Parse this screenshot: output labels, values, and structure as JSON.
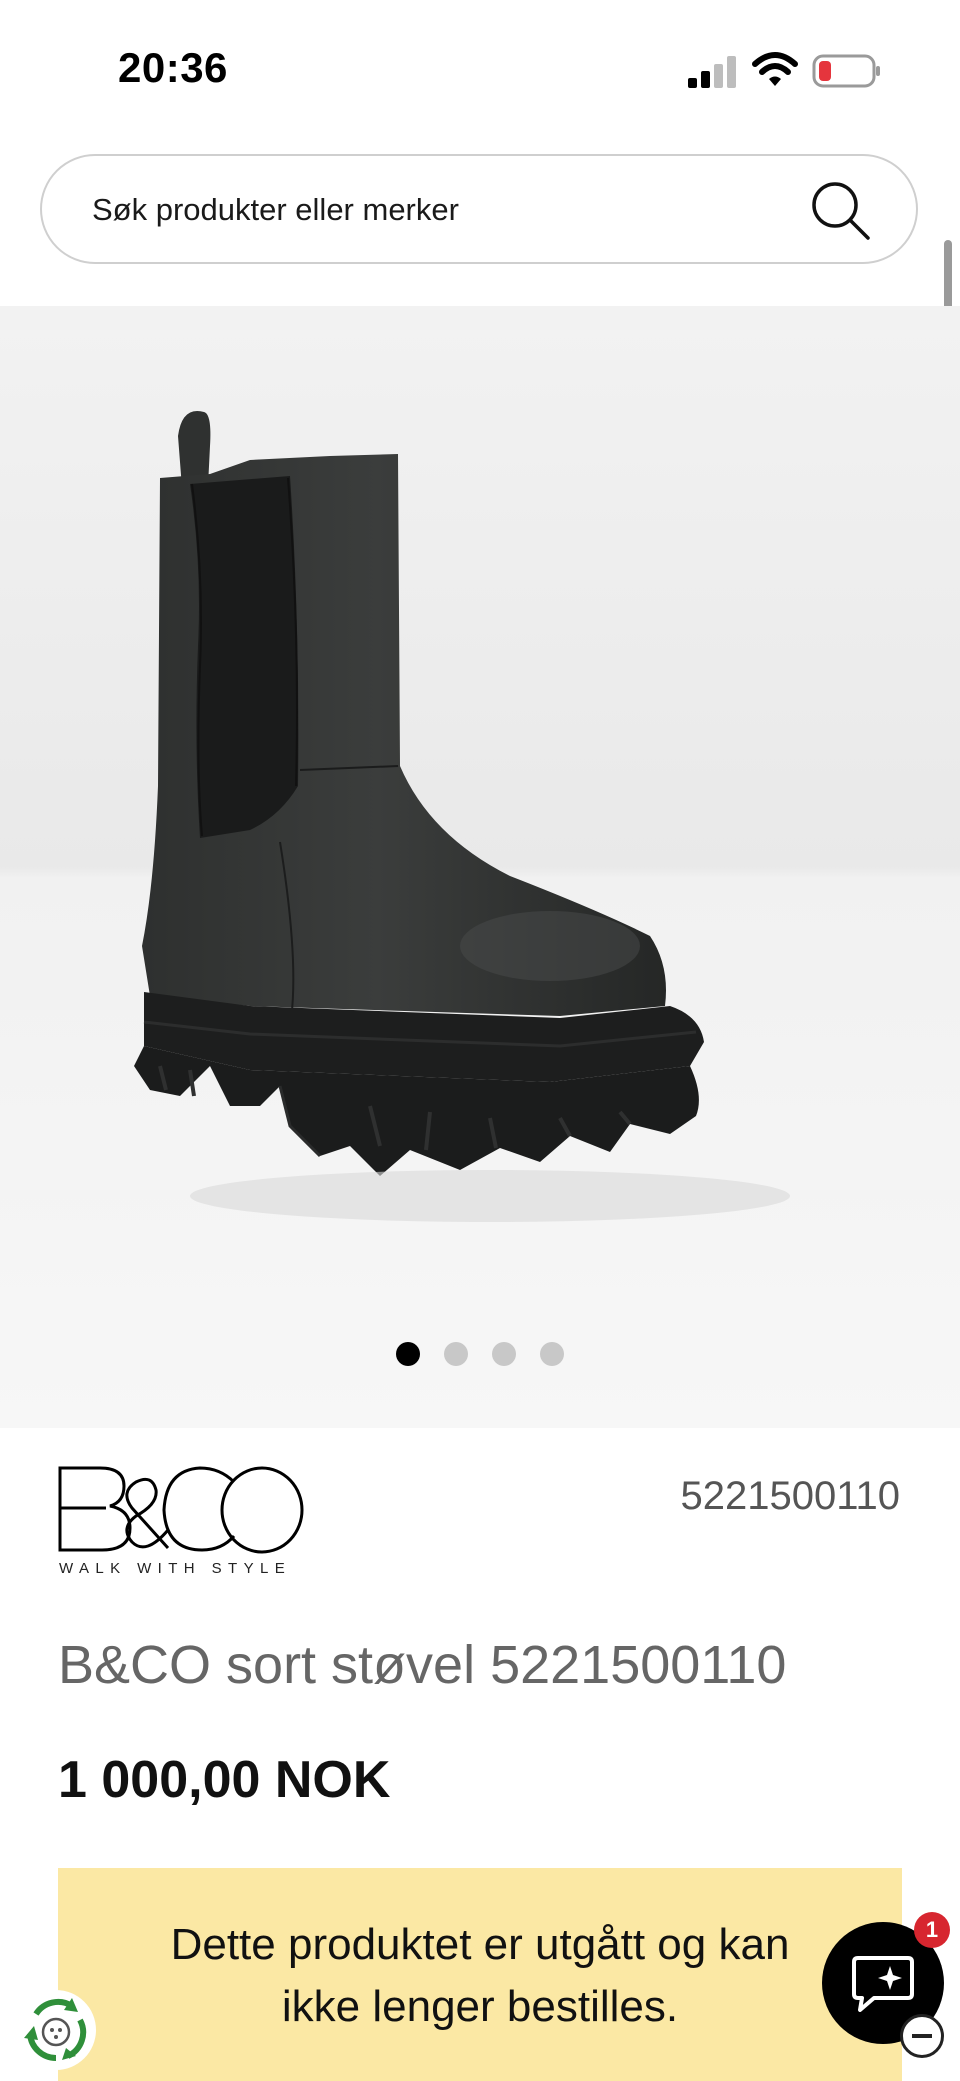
{
  "status_bar": {
    "time": "20:36",
    "icons": [
      "signal-icon",
      "wifi-icon",
      "battery-low-icon"
    ],
    "battery_color": "#e5353d"
  },
  "search": {
    "placeholder": "Søk produkter eller merker",
    "icon": "search-icon"
  },
  "gallery": {
    "image": "black-chelsea-boot",
    "slide_count": 4,
    "active_slide": 1
  },
  "product": {
    "brand_name": "B&CO",
    "brand_tagline": "WALK WITH STYLE",
    "article_number": "5221500110",
    "title": "B&CO sort støvel 5221500110",
    "price": "1 000,00 NOK"
  },
  "notice": {
    "line1": "Dette produktet er utgått og kan",
    "line2": "ikke lenger bestilles.",
    "background": "#fbe8a4"
  },
  "chat": {
    "icon": "chat-sparkle-icon",
    "badge_count": "1",
    "badge_color": "#d7262f"
  },
  "recycle": {
    "icon": "recycle-icon"
  }
}
